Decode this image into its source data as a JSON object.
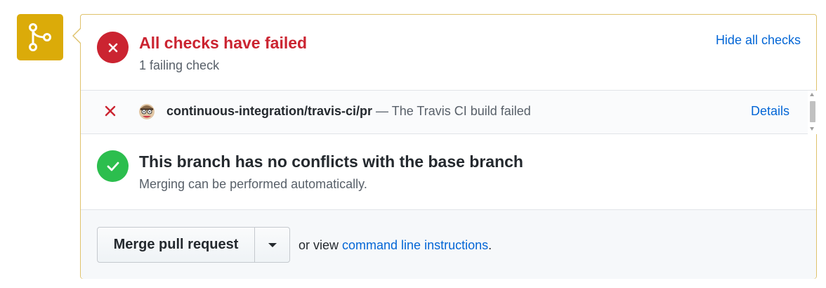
{
  "checks": {
    "heading": "All checks have failed",
    "subheading": "1 failing check",
    "toggle_label": "Hide all checks",
    "items": [
      {
        "name": "continuous-integration/travis-ci/pr",
        "description": " — The Travis CI build failed",
        "details_label": "Details",
        "status": "failed"
      }
    ]
  },
  "conflicts": {
    "heading": "This branch has no conflicts with the base branch",
    "subheading": "Merging can be performed automatically."
  },
  "merge": {
    "button_label": "Merge pull request",
    "or_view_text": "or view ",
    "cli_link_text": "command line instructions",
    "trailing": "."
  },
  "colors": {
    "fail": "#cb2431",
    "success": "#2cbe4e",
    "merge_icon_bg": "#dbab09",
    "link": "#0366d6"
  },
  "icons": {
    "merge": "git-branch-icon",
    "fail": "x-icon",
    "ok": "check-icon",
    "avatar": "travis-ci-avatar",
    "dropdown": "triangle-down-icon"
  }
}
